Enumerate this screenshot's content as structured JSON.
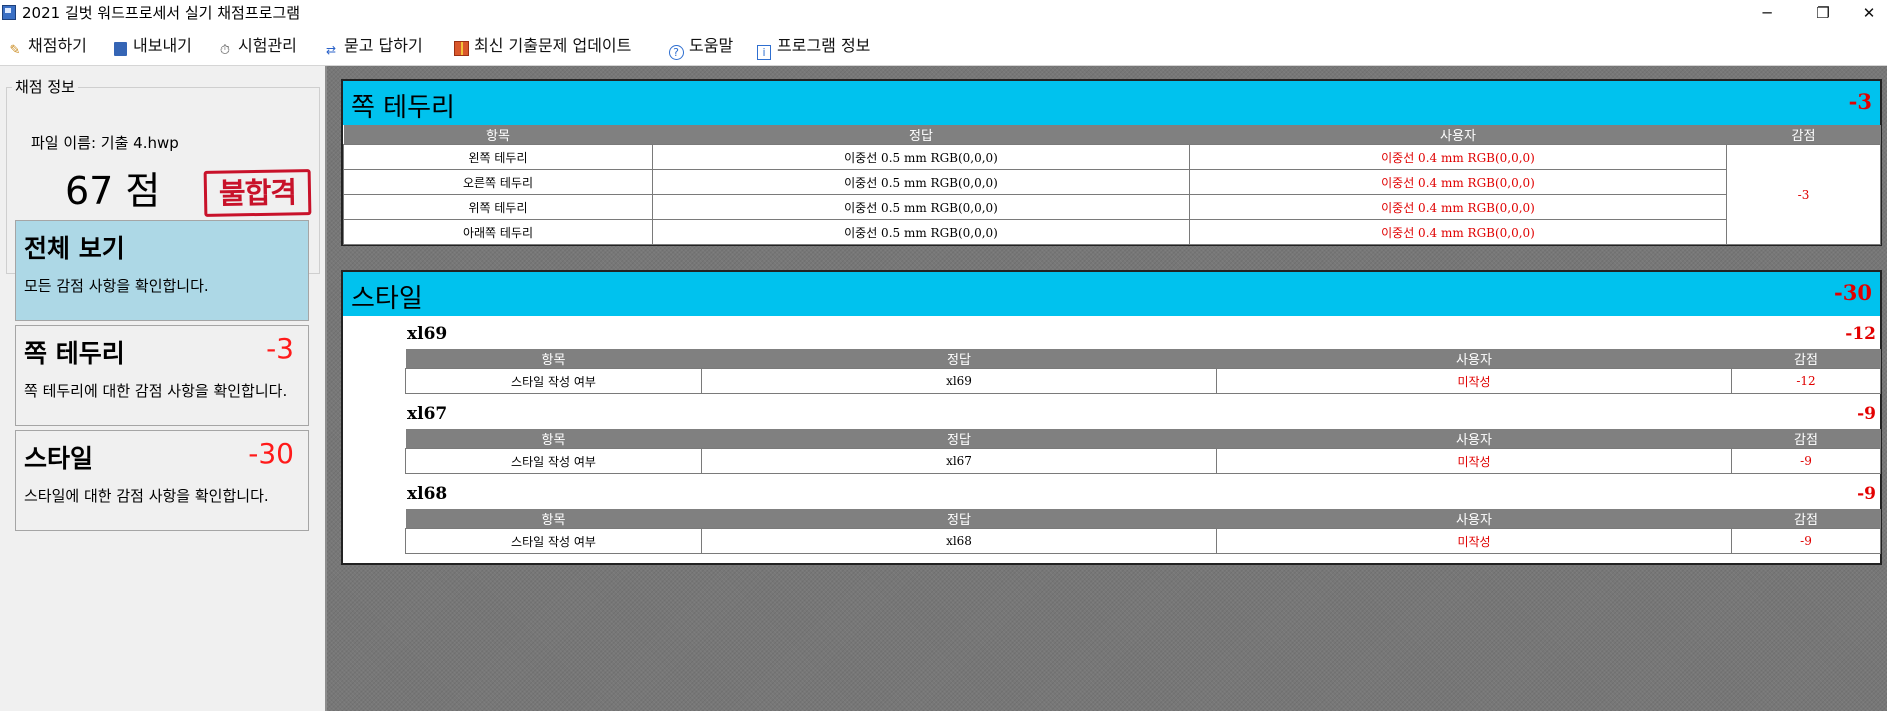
{
  "window": {
    "title": "2021 길벗 워드프로세서 실기 채점프로그램",
    "controls": [
      "─",
      "❐",
      "✕"
    ]
  },
  "toolbar": [
    {
      "label": "채점하기",
      "icon": "pencil-icon"
    },
    {
      "label": "내보내기",
      "icon": "save-icon"
    },
    {
      "label": "시험관리",
      "icon": "stopwatch-icon"
    },
    {
      "label": "묻고 답하기",
      "icon": "qna-icon"
    },
    {
      "label": "최신 기출문제 업데이트",
      "icon": "gift-icon"
    },
    {
      "label": "도움말",
      "icon": "help-icon"
    },
    {
      "label": "프로그램 정보",
      "icon": "info-icon"
    }
  ],
  "score_panel": {
    "legend": "채점 정보",
    "file_name": "파일 이름: 기출 4.hwp",
    "score": "67 점",
    "result_stamp": "불합격"
  },
  "nav": [
    {
      "title": "전체 보기",
      "deduction": "",
      "desc": "모든 감점 사항을 확인합니다."
    },
    {
      "title": "쪽 테두리",
      "deduction": "-3",
      "desc": "쪽 테두리에 대한 감점 사항을 확인합니다."
    },
    {
      "title": "스타일",
      "deduction": "-30",
      "desc": "스타일에 대한 감점 사항을 확인합니다."
    }
  ],
  "sections": {
    "border": {
      "title": "쪽 테두리",
      "deduction": "-3",
      "headers": [
        "항목",
        "정답",
        "사용자",
        "감점"
      ],
      "rows": [
        {
          "item": "왼쪽 테두리",
          "answer": "이중선 0.5 mm RGB(0,0,0)",
          "user": "이중선 0.4 mm RGB(0,0,0)"
        },
        {
          "item": "오른쪽 테두리",
          "answer": "이중선 0.5 mm RGB(0,0,0)",
          "user": "이중선 0.4 mm RGB(0,0,0)"
        },
        {
          "item": "위쪽 테두리",
          "answer": "이중선 0.5 mm RGB(0,0,0)",
          "user": "이중선 0.4 mm RGB(0,0,0)"
        },
        {
          "item": "아래쪽 테두리",
          "answer": "이중선 0.5 mm RGB(0,0,0)",
          "user": "이중선 0.4 mm RGB(0,0,0)"
        }
      ],
      "row_deduction": "-3"
    },
    "style": {
      "title": "스타일",
      "deduction": "-30",
      "headers": [
        "항목",
        "정답",
        "사용자",
        "감점"
      ],
      "groups": [
        {
          "name": "xl69",
          "deduction": "-12",
          "row": {
            "item": "스타일 작성 여부",
            "answer": "xl69",
            "user": "미작성",
            "deduct": "-12"
          }
        },
        {
          "name": "xl67",
          "deduction": "-9",
          "row": {
            "item": "스타일 작성 여부",
            "answer": "xl67",
            "user": "미작성",
            "deduct": "-9"
          }
        },
        {
          "name": "xl68",
          "deduction": "-9",
          "row": {
            "item": "스타일 작성 여부",
            "answer": "xl68",
            "user": "미작성",
            "deduct": "-9"
          }
        }
      ]
    }
  },
  "colors": {
    "section_header": "#00c2ee",
    "active_nav": "#add8e6",
    "deduction_red": "#ff0000",
    "table_header": "#808080",
    "workspace": "#777777"
  }
}
